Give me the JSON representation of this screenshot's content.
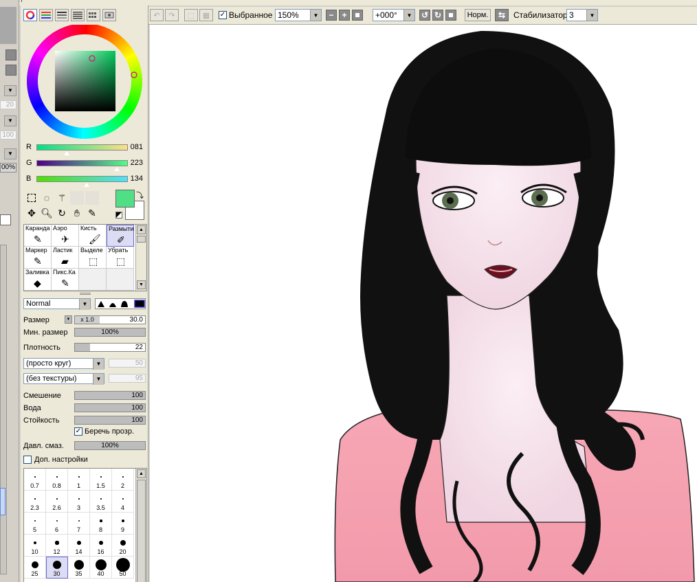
{
  "toolbar": {
    "selected_checkbox_label": "Выбранное",
    "selected_checked": true,
    "zoom": "150%",
    "rotation": "+000°",
    "normal_button": "Норм.",
    "stabilizer_label": "Стабилизатор",
    "stabilizer_value": "3"
  },
  "left_column": {
    "values": [
      "20",
      "100",
      "00%"
    ]
  },
  "color": {
    "r_label": "R",
    "r_value": "081",
    "g_label": "G",
    "g_value": "223",
    "b_label": "B",
    "b_value": "134",
    "current_color": "#51df86",
    "accent": "#51df86"
  },
  "brushes": [
    {
      "label": "Каранда",
      "icon": "pencil-icon"
    },
    {
      "label": "Аэро",
      "icon": "airbrush-icon"
    },
    {
      "label": "Кисть",
      "icon": "brush-icon"
    },
    {
      "label": "Размыти",
      "icon": "blur-icon",
      "selected": true
    },
    {
      "label": "Маркер",
      "icon": "marker-icon"
    },
    {
      "label": "Ластик",
      "icon": "eraser-icon"
    },
    {
      "label": "Выделе",
      "icon": "select-pen-icon"
    },
    {
      "label": "Убрать",
      "icon": "deselect-icon"
    },
    {
      "label": "Заливка",
      "icon": "bucket-icon"
    },
    {
      "label": "Пикс.Ка",
      "icon": "pixel-pen-icon"
    }
  ],
  "blend_mode": "Normal",
  "params": {
    "size_label": "Размер",
    "size_mult": "x 1.0",
    "size_value": "30.0",
    "min_size_label": "Мин. размер",
    "min_size_value": "100%",
    "density_label": "Плотность",
    "density_value": "22",
    "shape": "(просто круг)",
    "shape_value": "50",
    "texture": "(без текстуры)",
    "texture_value": "95",
    "blending_label": "Смешение",
    "blending_value": "100",
    "water_label": "Вода",
    "water_value": "100",
    "persistence_label": "Стойкость",
    "persistence_value": "100",
    "keep_opacity_label": "Беречь прозр.",
    "keep_opacity_checked": true,
    "blur_pressure_label": "Давл. смаз.",
    "blur_pressure_value": "100%",
    "advanced_label": "Доп. настройки"
  },
  "sizes": [
    "0.7",
    "0.8",
    "1",
    "1.5",
    "2",
    "2.3",
    "2.6",
    "3",
    "3.5",
    "4",
    "5",
    "6",
    "7",
    "8",
    "9",
    "10",
    "12",
    "14",
    "16",
    "20",
    "25",
    "30",
    "35",
    "40",
    "50"
  ],
  "selected_size": "30"
}
